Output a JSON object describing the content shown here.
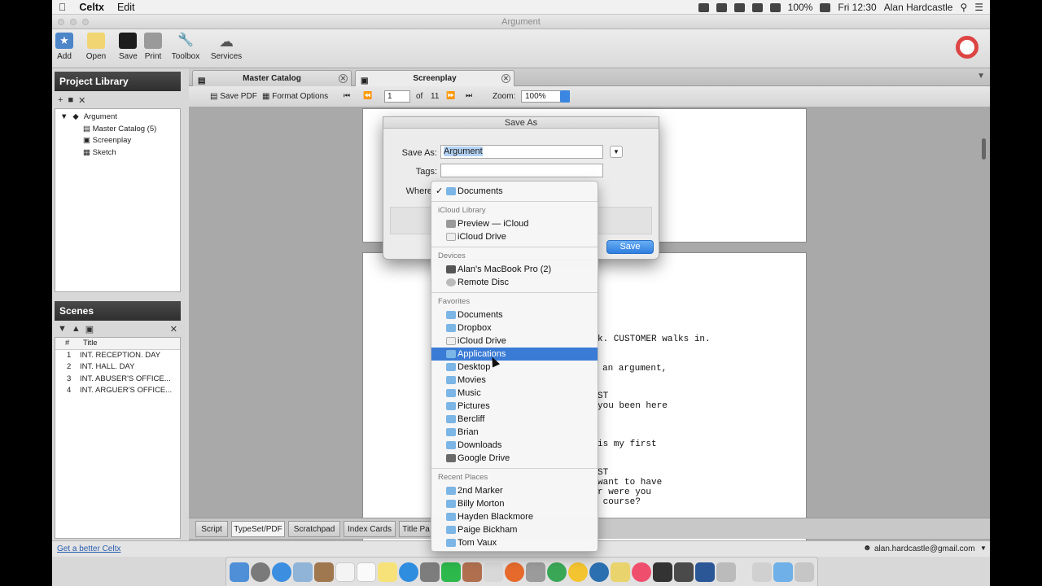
{
  "menubar": {
    "app_name": "Celtx",
    "edit": "Edit",
    "battery": "100%",
    "clock": "Fri 12:30",
    "user": "Alan Hardcastle"
  },
  "window_title": "Argument",
  "toolbar": {
    "add": "Add",
    "open": "Open",
    "save": "Save",
    "print": "Print",
    "toolbox": "Toolbox",
    "services": "Services"
  },
  "project_library": {
    "title": "Project Library",
    "root": "Argument",
    "items": [
      "Master Catalog (5)",
      "Screenplay",
      "Sketch"
    ]
  },
  "scenes": {
    "title": "Scenes",
    "col_num": "#",
    "col_title": "Title",
    "rows": [
      {
        "n": "1",
        "title": "INT. RECEPTION. DAY"
      },
      {
        "n": "2",
        "title": "INT. HALL. DAY"
      },
      {
        "n": "3",
        "title": "INT. ABUSER'S OFFICE..."
      },
      {
        "n": "4",
        "title": "INT. ARGUER'S OFFICE..."
      }
    ]
  },
  "doc_tabs": [
    "Master Catalog",
    "Screenplay"
  ],
  "doc_toolbar": {
    "save_pdf": "Save PDF",
    "format_options": "Format Options",
    "page": "1",
    "of": "of",
    "total": "11",
    "zoom_label": "Zoom:",
    "zoom_value": "100%"
  },
  "script_lines": [
    "k. CUSTOMER walks in.",
    "an argument,",
    "ST",
    "you been here",
    "is my first",
    "ST",
    "want to have",
    "r were you",
    " course?"
  ],
  "bottom_tabs": [
    "Script",
    "TypeSet/PDF",
    "Scratchpad",
    "Index Cards",
    "Title Pa"
  ],
  "status": {
    "link": "Get a better Celtx",
    "account": "alan.hardcastle@gmail.com"
  },
  "dialog": {
    "title": "Save As",
    "save_as_label": "Save As:",
    "save_as_value": "Argument",
    "tags_label": "Tags:",
    "where_label": "Where",
    "save_button": "Save"
  },
  "where_menu": {
    "selected": "Documents",
    "icloud_header": "iCloud Library",
    "icloud_items": [
      "Preview — iCloud",
      "iCloud Drive"
    ],
    "devices_header": "Devices",
    "devices_items": [
      "Alan's MacBook Pro (2)",
      "Remote Disc"
    ],
    "favorites_header": "Favorites",
    "favorites_items": [
      "Documents",
      "Dropbox",
      "iCloud Drive",
      "Applications",
      "Desktop",
      "Movies",
      "Music",
      "Pictures",
      "Bercliff",
      "Brian",
      "Downloads",
      "Google Drive"
    ],
    "highlighted": "Applications",
    "recent_header": "Recent Places",
    "recent_items": [
      "2nd Marker",
      "Billy Morton",
      "Hayden Blackmore",
      "Paige Bickham",
      "Tom Vaux"
    ]
  }
}
